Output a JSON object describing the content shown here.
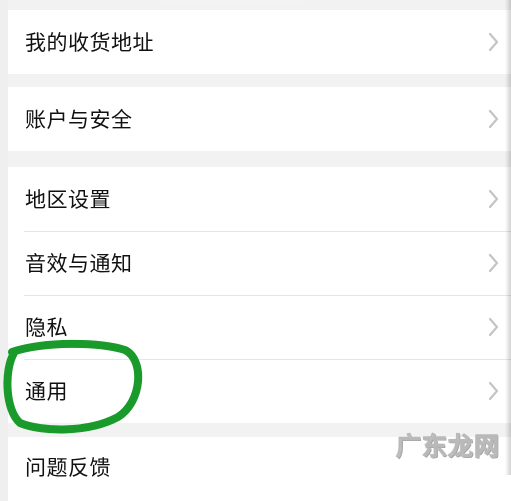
{
  "settings": {
    "items": [
      {
        "label": "我的收货地址"
      },
      {
        "label": "账户与安全"
      },
      {
        "label": "地区设置"
      },
      {
        "label": "音效与通知"
      },
      {
        "label": "隐私"
      },
      {
        "label": "通用"
      },
      {
        "label": "问题反馈"
      }
    ]
  },
  "watermark": {
    "text": "广东龙网"
  },
  "colors": {
    "page_background": "#f2f2f2",
    "row_background": "#ffffff",
    "label_text": "#111111",
    "divider": "#e6e6e6",
    "chevron": "#c4c4c4",
    "circle_marker": "#1a9a2a"
  },
  "icons": {
    "chevron": "chevron-right-icon"
  }
}
